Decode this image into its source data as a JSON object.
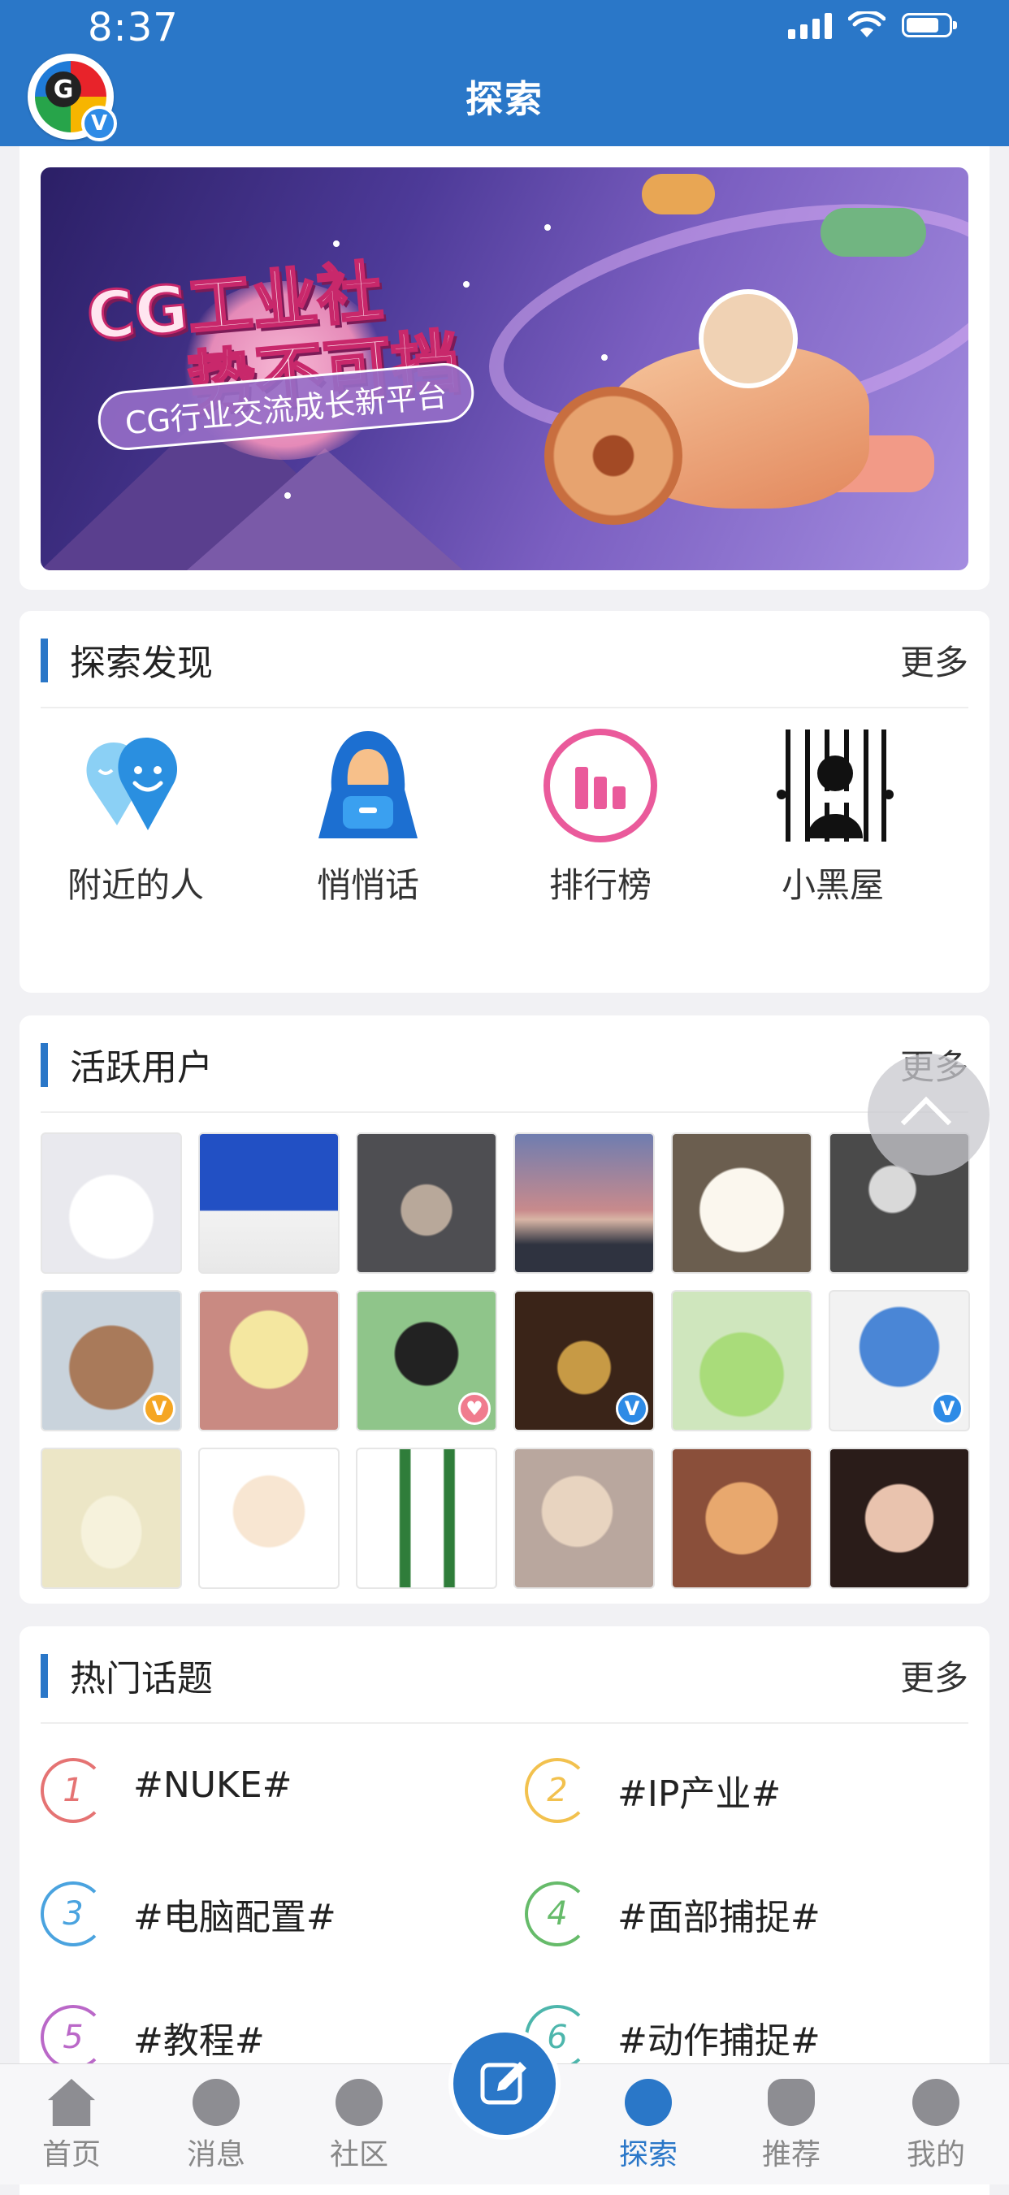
{
  "status_bar": {
    "time": "8:37"
  },
  "header": {
    "title": "探索"
  },
  "banner": {
    "headline_line1": "CG工业社",
    "headline_line2": "势不可挡",
    "subtitle": "CG行业交流成长新平台"
  },
  "discover": {
    "title": "探索发现",
    "more": "更多",
    "items": [
      {
        "label": "附近的人",
        "icon": "location-smile-icon"
      },
      {
        "label": "悄悄话",
        "icon": "hooded-figure-icon"
      },
      {
        "label": "排行榜",
        "icon": "bar-chart-icon"
      },
      {
        "label": "小黑屋",
        "icon": "jail-bars-icon"
      }
    ]
  },
  "active_users": {
    "title": "活跃用户",
    "more": "更多"
  },
  "hot_topics": {
    "title": "热门话题",
    "more": "更多",
    "items": [
      {
        "rank": "1",
        "label": "#NUKE#",
        "color": "#e57373"
      },
      {
        "rank": "2",
        "label": "#IP产业#",
        "color": "#f2c14e"
      },
      {
        "rank": "3",
        "label": "#电脑配置#",
        "color": "#4aa3df"
      },
      {
        "rank": "4",
        "label": "#面部捕捉#",
        "color": "#66bb6a"
      },
      {
        "rank": "5",
        "label": "#教程#",
        "color": "#ba68c8"
      },
      {
        "rank": "6",
        "label": "#动作捕捉#",
        "color": "#4db6ac"
      }
    ]
  },
  "tabbar": {
    "home": "首页",
    "messages": "消息",
    "community": "社区",
    "explore": "探索",
    "recommend": "推荐",
    "mine": "我的"
  },
  "colors": {
    "primary": "#2a77c8",
    "badge_orange": "#f5a623",
    "badge_blue": "#2e8be6"
  }
}
